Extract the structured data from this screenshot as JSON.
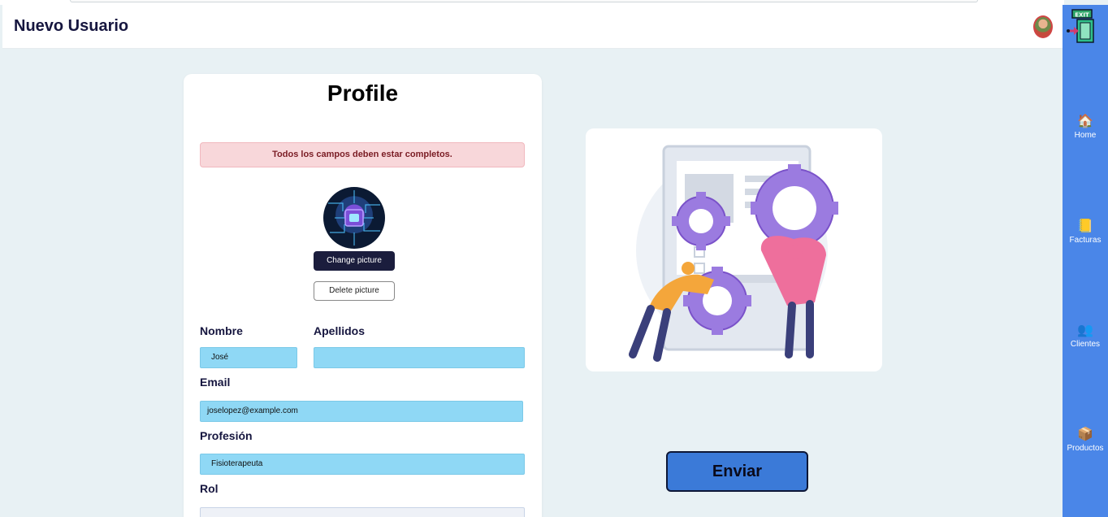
{
  "header": {
    "title": "Nuevo Usuario"
  },
  "sidebar": {
    "exit_label": "EXIT",
    "items": [
      {
        "label": "Home",
        "icon": "home-icon"
      },
      {
        "label": "Facturas",
        "icon": "invoice-icon"
      },
      {
        "label": "Clientes",
        "icon": "clients-icon"
      },
      {
        "label": "Productos",
        "icon": "products-icon"
      }
    ]
  },
  "profile": {
    "heading": "Profile",
    "alert": "Todos los campos deben estar completos.",
    "change_picture": "Change picture",
    "delete_picture": "Delete picture",
    "fields": {
      "nombre": {
        "label": "Nombre",
        "value": "José"
      },
      "apellidos": {
        "label": "Apellidos",
        "value": ""
      },
      "email": {
        "label": "Email",
        "value": "joselopez@example.com"
      },
      "profesion": {
        "label": "Profesión",
        "value": "Fisioterapeuta"
      },
      "rol": {
        "label": "Rol",
        "value": ""
      }
    }
  },
  "actions": {
    "send": "Enviar"
  },
  "colors": {
    "accent": "#4a86e8",
    "field": "#8fd8f5",
    "alert_bg": "#f8d7da",
    "button_dark": "#1b1d3d"
  }
}
